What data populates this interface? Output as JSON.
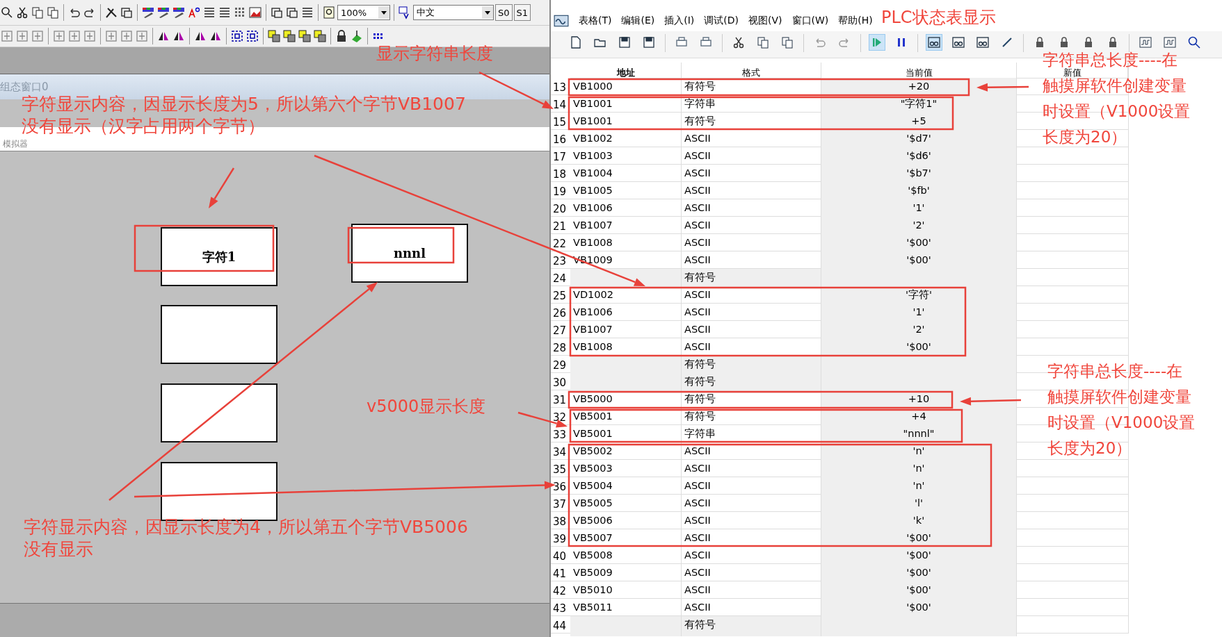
{
  "designer": {
    "toolbar": {
      "zoom": "100%",
      "language": "中文",
      "state_buttons": [
        "S0",
        "S1"
      ]
    },
    "window_title": "组态窗口0",
    "simulator_title": "模拟器",
    "display_boxes": [
      {
        "kind": "text",
        "value": "字符1"
      },
      {
        "kind": "text",
        "value": "nnnl"
      },
      {
        "kind": "blank"
      },
      {
        "kind": "blank"
      },
      {
        "kind": "blank"
      }
    ]
  },
  "status_table": {
    "menu": [
      "表格(T)",
      "编辑(E)",
      "插入(I)",
      "调试(D)",
      "视图(V)",
      "窗口(W)",
      "帮助(H)"
    ],
    "columns": [
      "地址",
      "格式",
      "当前值",
      "新值"
    ],
    "rows": [
      {
        "no": "13",
        "address": "VB1000",
        "format": "有符号",
        "value": "+20"
      },
      {
        "no": "14",
        "address": "VB1001",
        "format": "字符串",
        "value": "\"字符1\""
      },
      {
        "no": "15",
        "address": "VB1001",
        "format": "有符号",
        "value": "+5"
      },
      {
        "no": "16",
        "address": "VB1002",
        "format": "ASCII",
        "value": "'$d7'"
      },
      {
        "no": "17",
        "address": "VB1003",
        "format": "ASCII",
        "value": "'$d6'"
      },
      {
        "no": "18",
        "address": "VB1004",
        "format": "ASCII",
        "value": "'$b7'"
      },
      {
        "no": "19",
        "address": "VB1005",
        "format": "ASCII",
        "value": "'$fb'"
      },
      {
        "no": "20",
        "address": "VB1006",
        "format": "ASCII",
        "value": "'1'"
      },
      {
        "no": "21",
        "address": "VB1007",
        "format": "ASCII",
        "value": "'2'"
      },
      {
        "no": "22",
        "address": "VB1008",
        "format": "ASCII",
        "value": "'$00'"
      },
      {
        "no": "23",
        "address": "VB1009",
        "format": "ASCII",
        "value": "'$00'"
      },
      {
        "no": "24",
        "format": "有符号"
      },
      {
        "no": "25",
        "address": "VD1002",
        "format": "ASCII",
        "value": "'字符'"
      },
      {
        "no": "26",
        "address": "VB1006",
        "format": "ASCII",
        "value": "'1'"
      },
      {
        "no": "27",
        "address": "VB1007",
        "format": "ASCII",
        "value": "'2'"
      },
      {
        "no": "28",
        "address": "VB1008",
        "format": "ASCII",
        "value": "'$00'"
      },
      {
        "no": "29",
        "format": "有符号"
      },
      {
        "no": "30",
        "format": "有符号"
      },
      {
        "no": "31",
        "address": "VB5000",
        "format": "有符号",
        "value": "+10"
      },
      {
        "no": "32",
        "address": "VB5001",
        "format": "有符号",
        "value": "+4"
      },
      {
        "no": "33",
        "address": "VB5001",
        "format": "字符串",
        "value": "\"nnnl\""
      },
      {
        "no": "34",
        "address": "VB5002",
        "format": "ASCII",
        "value": "'n'"
      },
      {
        "no": "35",
        "address": "VB5003",
        "format": "ASCII",
        "value": "'n'"
      },
      {
        "no": "36",
        "address": "VB5004",
        "format": "ASCII",
        "value": "'n'"
      },
      {
        "no": "37",
        "address": "VB5005",
        "format": "ASCII",
        "value": "'l'"
      },
      {
        "no": "38",
        "address": "VB5006",
        "format": "ASCII",
        "value": "'k'"
      },
      {
        "no": "39",
        "address": "VB5007",
        "format": "ASCII",
        "value": "'$00'"
      },
      {
        "no": "40",
        "address": "VB5008",
        "format": "ASCII",
        "value": "'$00'"
      },
      {
        "no": "41",
        "address": "VB5009",
        "format": "ASCII",
        "value": "'$00'"
      },
      {
        "no": "42",
        "address": "VB5010",
        "format": "ASCII",
        "value": "'$00'"
      },
      {
        "no": "43",
        "address": "VB5011",
        "format": "ASCII",
        "value": "'$00'"
      },
      {
        "no": "44",
        "format": "有符号"
      }
    ]
  },
  "annotations": [
    {
      "lines": [
        "显示字符串长度"
      ]
    },
    {
      "lines": [
        "PLC状态表显示"
      ]
    },
    {
      "lines": [
        "字符显示内容，因显示长度为5，所以第六个字节VB1007",
        "没有显示（汉字占用两个字节）"
      ]
    },
    {
      "lines": [
        "字符串总长度----在",
        "触摸屏软件创建变量",
        "时设置（V1000设置",
        "长度为20）"
      ]
    },
    {
      "lines": [
        "v5000显示长度"
      ]
    },
    {
      "lines": [
        "字符串总长度----在",
        "触摸屏软件创建变量",
        "时设置（V1000设置",
        "长度为20）"
      ]
    },
    {
      "lines": [
        "字符显示内容，因显示长度为4，所以第五个字节VB5006",
        "没有显示"
      ]
    }
  ]
}
